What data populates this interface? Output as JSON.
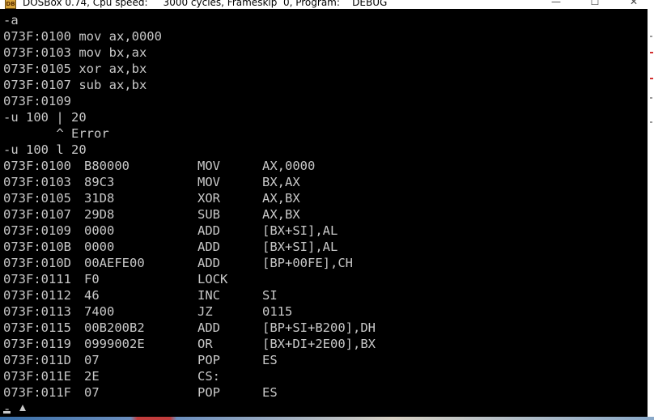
{
  "window": {
    "title": "DOSBox 0.74, Cpu speed:     3000 cycles, Frameskip  0, Program:    DEBUG",
    "icon_name": "dosbox-app-icon",
    "icon_text": "DB",
    "minimize_symbol": "—",
    "maximize_symbol": "☐",
    "close_symbol": "✕"
  },
  "console": {
    "plain_lines": [
      "-a",
      "073F:0100 mov ax,0000",
      "073F:0103 mov bx,ax",
      "073F:0105 xor ax,bx",
      "073F:0107 sub ax,bx",
      "073F:0109",
      "-u 100 | 20",
      "       ^ Error",
      "-u 100 l 20"
    ],
    "disasm_rows": [
      {
        "address": "073F:0100",
        "bytes": "B80000",
        "mnemonic": "MOV",
        "operands": "AX,0000"
      },
      {
        "address": "073F:0103",
        "bytes": "89C3",
        "mnemonic": "MOV",
        "operands": "BX,AX"
      },
      {
        "address": "073F:0105",
        "bytes": "31D8",
        "mnemonic": "XOR",
        "operands": "AX,BX"
      },
      {
        "address": "073F:0107",
        "bytes": "29D8",
        "mnemonic": "SUB",
        "operands": "AX,BX"
      },
      {
        "address": "073F:0109",
        "bytes": "0000",
        "mnemonic": "ADD",
        "operands": "[BX+SI],AL"
      },
      {
        "address": "073F:010B",
        "bytes": "0000",
        "mnemonic": "ADD",
        "operands": "[BX+SI],AL"
      },
      {
        "address": "073F:010D",
        "bytes": "00AEFE00",
        "mnemonic": "ADD",
        "operands": "[BP+00FE],CH"
      },
      {
        "address": "073F:0111",
        "bytes": "F0",
        "mnemonic": "LOCK",
        "operands": ""
      },
      {
        "address": "073F:0112",
        "bytes": "46",
        "mnemonic": "INC",
        "operands": "SI"
      },
      {
        "address": "073F:0113",
        "bytes": "7400",
        "mnemonic": "JZ",
        "operands": "0115"
      },
      {
        "address": "073F:0115",
        "bytes": "00B200B2",
        "mnemonic": "ADD",
        "operands": "[BP+SI+B200],DH"
      },
      {
        "address": "073F:0119",
        "bytes": "0999002E",
        "mnemonic": "OR",
        "operands": "[BX+DI+2E00],BX"
      },
      {
        "address": "073F:011D",
        "bytes": "07",
        "mnemonic": "POP",
        "operands": "ES"
      },
      {
        "address": "073F:011E",
        "bytes": "2E",
        "mnemonic": "CS:",
        "operands": ""
      },
      {
        "address": "073F:011F",
        "bytes": "07",
        "mnemonic": "POP",
        "operands": "ES"
      }
    ],
    "prompt": "-"
  },
  "colors": {
    "console_bg": "#000000",
    "console_fg": "#c8c8c8",
    "titlebar_bg": "#ffffff"
  }
}
